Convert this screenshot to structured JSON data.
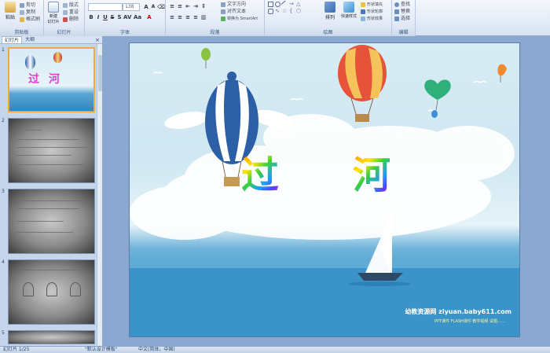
{
  "ribbon": {
    "groups": {
      "clipboard": "剪贴板",
      "slides": "幻灯片",
      "font": "字体",
      "paragraph": "段落",
      "drawing": "绘图",
      "editing": "编辑"
    },
    "paste": "粘贴",
    "cut": "剪切",
    "copy": "复制",
    "format_painter": "格式刷",
    "new_slide": "新建\n幻灯片",
    "layout": "版式",
    "reset": "重设",
    "delete": "删除",
    "font_size": "138",
    "text_direction": "文字方向",
    "align_text": "对齐文本",
    "convert_smartart": "转换为 SmartArt",
    "arrange": "排列",
    "quick_styles": "快速样式",
    "shape_fill": "形状填充",
    "shape_outline": "形状轮廓",
    "shape_effects": "形状效果",
    "find": "查找",
    "replace": "替换",
    "select": "选择"
  },
  "panel": {
    "tab_slides": "幻灯片",
    "tab_outline": "大纲",
    "close": "×",
    "thumb_numbers": [
      "1",
      "2",
      "3",
      "4",
      "5"
    ]
  },
  "slide": {
    "title_char_1": "过",
    "title_char_2": "河",
    "watermark": "幼教资源网 ziyuan.baby611.com",
    "watermark_sub": "PPT课件 FLASH课件 教学视频 试题……"
  },
  "status": {
    "slide_info": "幻灯片 1/25",
    "theme": "\"默认设计模板\"",
    "language": "中文(简体，中国)"
  },
  "colors": {
    "accent": "#f2a93b",
    "ribbon_bg": "#e4ecf7",
    "panel_bg": "#c5d5ea",
    "sea": "#3a94c9"
  }
}
